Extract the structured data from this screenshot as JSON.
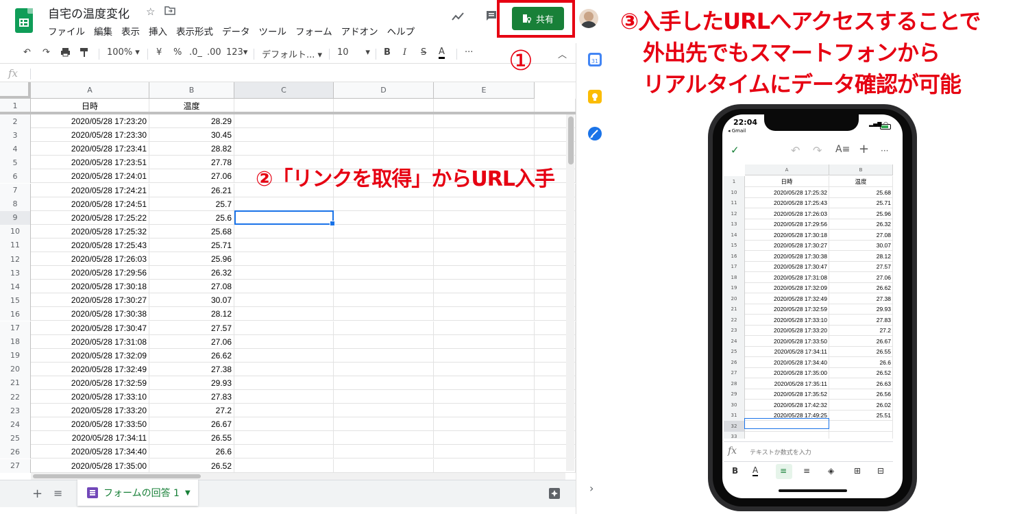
{
  "sheets": {
    "doc_title": "自宅の温度変化",
    "menu": [
      "ファイル",
      "編集",
      "表示",
      "挿入",
      "表示形式",
      "データ",
      "ツール",
      "フォーム",
      "アドオン",
      "ヘルプ"
    ],
    "share_label": "共有",
    "toolbar": {
      "zoom": "100%",
      "currency": "¥",
      "percent": "%",
      "dec_less": ".0_",
      "dec_more": ".00",
      "num_format": "123",
      "font": "デフォルト...",
      "font_size": "10",
      "bold": "B",
      "italic": "I",
      "strike": "S",
      "text_color": "A",
      "more": "···"
    },
    "fx_label": "fx",
    "columns": [
      "A",
      "B",
      "C",
      "D",
      "E"
    ],
    "header_row": {
      "num": "1",
      "a": "日時",
      "b": "温度"
    },
    "rows": [
      {
        "num": "2",
        "a": "2020/05/28 17:23:20",
        "b": "28.29"
      },
      {
        "num": "3",
        "a": "2020/05/28 17:23:30",
        "b": "30.45"
      },
      {
        "num": "4",
        "a": "2020/05/28 17:23:41",
        "b": "28.82"
      },
      {
        "num": "5",
        "a": "2020/05/28 17:23:51",
        "b": "27.78"
      },
      {
        "num": "6",
        "a": "2020/05/28 17:24:01",
        "b": "27.06"
      },
      {
        "num": "7",
        "a": "2020/05/28 17:24:21",
        "b": "26.21"
      },
      {
        "num": "8",
        "a": "2020/05/28 17:24:51",
        "b": "25.7"
      },
      {
        "num": "9",
        "a": "2020/05/28 17:25:22",
        "b": "25.6"
      },
      {
        "num": "10",
        "a": "2020/05/28 17:25:32",
        "b": "25.68"
      },
      {
        "num": "11",
        "a": "2020/05/28 17:25:43",
        "b": "25.71"
      },
      {
        "num": "12",
        "a": "2020/05/28 17:26:03",
        "b": "25.96"
      },
      {
        "num": "13",
        "a": "2020/05/28 17:29:56",
        "b": "26.32"
      },
      {
        "num": "14",
        "a": "2020/05/28 17:30:18",
        "b": "27.08"
      },
      {
        "num": "15",
        "a": "2020/05/28 17:30:27",
        "b": "30.07"
      },
      {
        "num": "16",
        "a": "2020/05/28 17:30:38",
        "b": "28.12"
      },
      {
        "num": "17",
        "a": "2020/05/28 17:30:47",
        "b": "27.57"
      },
      {
        "num": "18",
        "a": "2020/05/28 17:31:08",
        "b": "27.06"
      },
      {
        "num": "19",
        "a": "2020/05/28 17:32:09",
        "b": "26.62"
      },
      {
        "num": "20",
        "a": "2020/05/28 17:32:49",
        "b": "27.38"
      },
      {
        "num": "21",
        "a": "2020/05/28 17:32:59",
        "b": "29.93"
      },
      {
        "num": "22",
        "a": "2020/05/28 17:33:10",
        "b": "27.83"
      },
      {
        "num": "23",
        "a": "2020/05/28 17:33:20",
        "b": "27.2"
      },
      {
        "num": "24",
        "a": "2020/05/28 17:33:50",
        "b": "26.67"
      },
      {
        "num": "25",
        "a": "2020/05/28 17:34:11",
        "b": "26.55"
      },
      {
        "num": "26",
        "a": "2020/05/28 17:34:40",
        "b": "26.6"
      },
      {
        "num": "27",
        "a": "2020/05/28 17:35:00",
        "b": "26.52"
      }
    ],
    "sheet_tab": "フォームの回答 1",
    "accent": "#188038",
    "selection_color": "#1a73e8"
  },
  "annotations": {
    "step1": "①",
    "step2": "②「リンクを取得」からURL入手",
    "step3_line1": "③入手したURLへアクセスすることで",
    "step3_line2": "外出先でもスマートフォンから",
    "step3_line3": "リアルタイムにデータ確認が可能",
    "color": "#e60012"
  },
  "phone": {
    "time": "22:04",
    "back_label": "◂ Gmail",
    "columns": [
      "A",
      "B"
    ],
    "header_row": {
      "num": "1",
      "a": "日時",
      "b": "温度"
    },
    "rows": [
      {
        "num": "10",
        "a": "2020/05/28 17:25:32",
        "b": "25.68"
      },
      {
        "num": "11",
        "a": "2020/05/28 17:25:43",
        "b": "25.71"
      },
      {
        "num": "12",
        "a": "2020/05/28 17:26:03",
        "b": "25.96"
      },
      {
        "num": "13",
        "a": "2020/05/28 17:29:56",
        "b": "26.32"
      },
      {
        "num": "14",
        "a": "2020/05/28 17:30:18",
        "b": "27.08"
      },
      {
        "num": "15",
        "a": "2020/05/28 17:30:27",
        "b": "30.07"
      },
      {
        "num": "16",
        "a": "2020/05/28 17:30:38",
        "b": "28.12"
      },
      {
        "num": "17",
        "a": "2020/05/28 17:30:47",
        "b": "27.57"
      },
      {
        "num": "18",
        "a": "2020/05/28 17:31:08",
        "b": "27.06"
      },
      {
        "num": "19",
        "a": "2020/05/28 17:32:09",
        "b": "26.62"
      },
      {
        "num": "20",
        "a": "2020/05/28 17:32:49",
        "b": "27.38"
      },
      {
        "num": "21",
        "a": "2020/05/28 17:32:59",
        "b": "29.93"
      },
      {
        "num": "22",
        "a": "2020/05/28 17:33:10",
        "b": "27.83"
      },
      {
        "num": "23",
        "a": "2020/05/28 17:33:20",
        "b": "27.2"
      },
      {
        "num": "24",
        "a": "2020/05/28 17:33:50",
        "b": "26.67"
      },
      {
        "num": "25",
        "a": "2020/05/28 17:34:11",
        "b": "26.55"
      },
      {
        "num": "26",
        "a": "2020/05/28 17:34:40",
        "b": "26.6"
      },
      {
        "num": "27",
        "a": "2020/05/28 17:35:00",
        "b": "26.52"
      },
      {
        "num": "28",
        "a": "2020/05/28 17:35:11",
        "b": "26.63"
      },
      {
        "num": "29",
        "a": "2020/05/28 17:35:52",
        "b": "26.56"
      },
      {
        "num": "30",
        "a": "2020/05/28 17:42:32",
        "b": "26.02"
      },
      {
        "num": "31",
        "a": "2020/05/28 17:49:25",
        "b": "25.51"
      }
    ],
    "empty_rows": [
      "32",
      "33"
    ],
    "fx_label": "fx",
    "fx_placeholder": "テキストか数式を入力"
  }
}
